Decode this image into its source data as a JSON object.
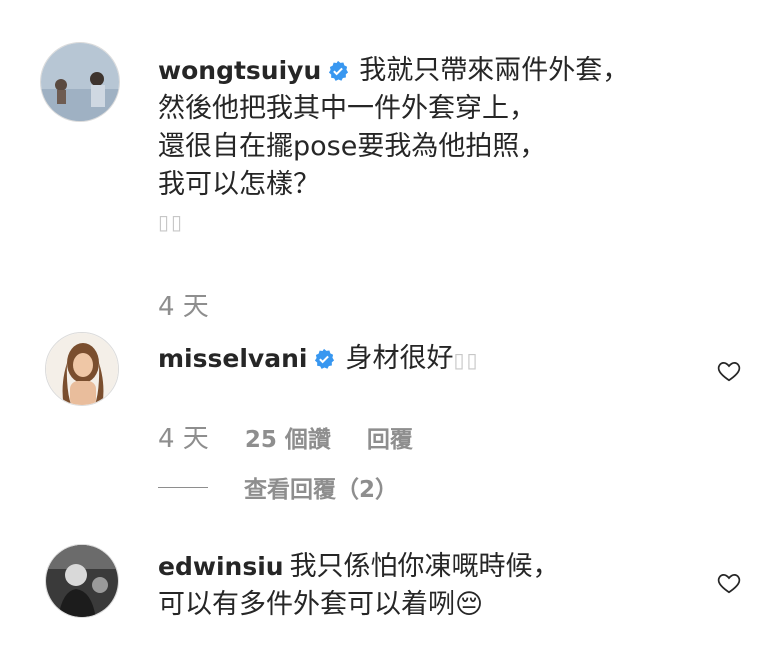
{
  "comments": [
    {
      "username": "wongtsuiyu",
      "verified": true,
      "text": "我就只帶來兩件外套，\n然後他把我其中一件外套穿上，\n還很自在擺pose要我為他拍照，\n我可以怎樣？",
      "trailing_glyph": "▯▯",
      "time": "4 天"
    },
    {
      "username": "misselvani",
      "verified": true,
      "text": "身材很好",
      "trailing_glyph": "▯▯",
      "time": "4 天",
      "likes": "25 個讚",
      "reply": "回覆",
      "view_replies": "查看回覆（2）"
    },
    {
      "username": "edwinsiu",
      "verified": false,
      "text": "我只係怕你凍嘅時候，\n可以有多件外套可以着咧😔"
    }
  ],
  "colors": {
    "text": "#262626",
    "muted": "#8e8e8e",
    "verified": "#3897f0"
  }
}
